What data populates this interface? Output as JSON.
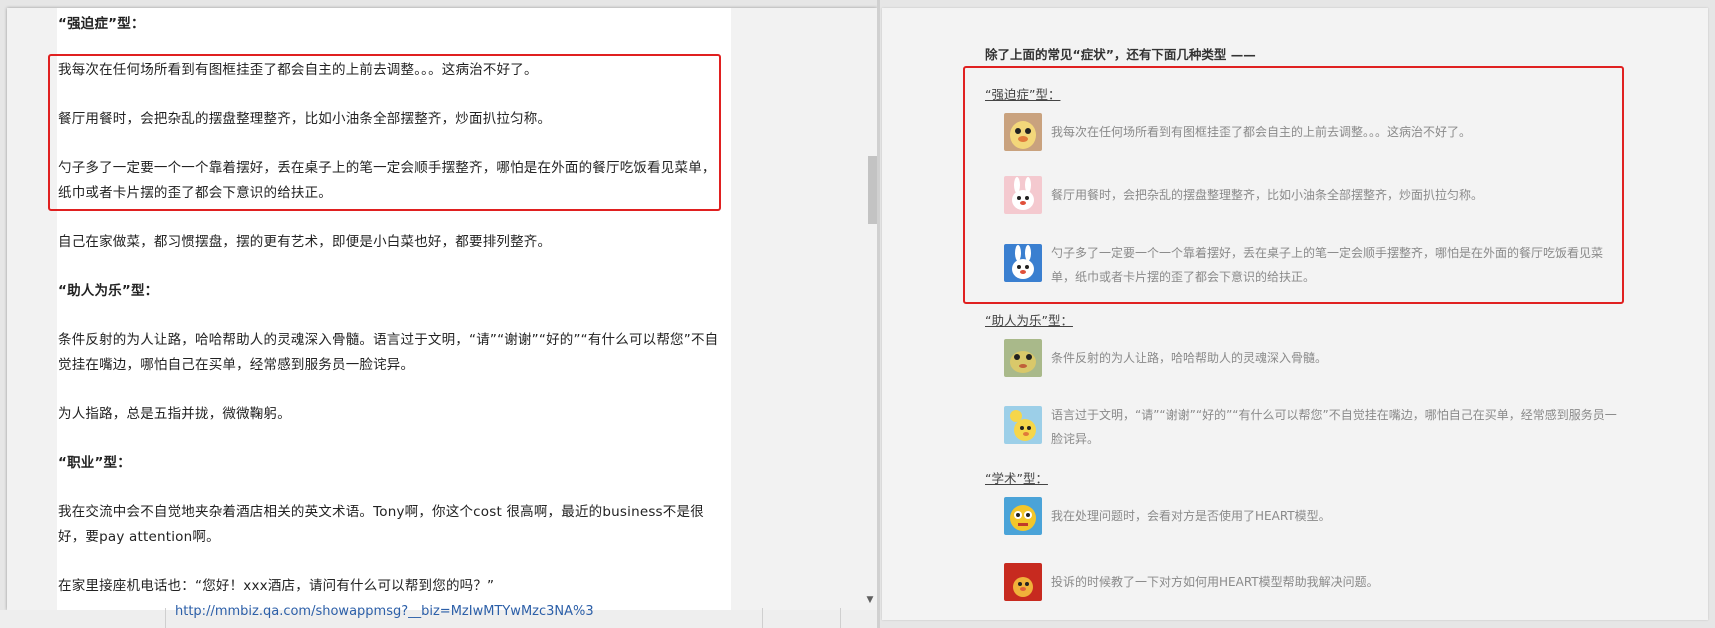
{
  "left_doc": {
    "paragraphs": [
      {
        "text": "“强迫症”型：",
        "bold": true
      },
      {
        "text": "我每次在任何场所看到有图框挂歪了都会自主的上前去调整。。。这病治不好了。",
        "bold": false
      },
      {
        "text": "餐厅用餐时，会把杂乱的摆盘整理整齐，比如小油条全部摆整齐，炒面扒拉匀称。",
        "bold": false
      },
      {
        "text": "勺子多了一定要一个一个靠着摆好，丢在桌子上的笔一定会顺手摆整齐，哪怕是在外面的餐厅吃饭看见菜单，纸巾或者卡片摆的歪了都会下意识的给扶正。",
        "bold": false
      },
      {
        "text": "自己在家做菜，都习惯摆盘，摆的更有艺术，即便是小白菜也好，都要排列整齐。",
        "bold": false
      },
      {
        "text": "“助人为乐”型：",
        "bold": true
      },
      {
        "text": "条件反射的为人让路，哈哈帮助人的灵魂深入骨髓。语言过于文明，“请”“谢谢”“好的”“有什么可以帮您”不自觉挂在嘴边，哪怕自己在买单，经常感到服务员一脸诧异。",
        "bold": false
      },
      {
        "text": "为人指路，总是五指并拢，微微鞠躬。",
        "bold": false
      },
      {
        "text": "“职业”型：",
        "bold": true
      },
      {
        "text": "我在交流中会不自觉地夹杂着酒店相关的英文术语。Tony啊，你这个cost 很高啊，最近的business不是很好，要pay attention啊。",
        "bold": false
      },
      {
        "text": "在家里接座机电话也：“您好！xxx酒店，请问有什么可以帮到您的吗？”",
        "bold": false
      }
    ],
    "link_text": "http://mmbiz.qa.com/showappmsg?__biz=MzIwMTYwMzc3NA%3"
  },
  "right_doc": {
    "intro": "除了上面的常见“症状”，还有下面几种类型 ——",
    "sections": [
      {
        "heading": "“强迫症”型：",
        "items": [
          {
            "avatar": "duck-avatar",
            "text": "我每次在任何场所看到有图框挂歪了都会自主的上前去调整。。。这病治不好了。"
          },
          {
            "avatar": "bunny-pink-avatar",
            "text": "餐厅用餐时，会把杂乱的摆盘整理整齐，比如小油条全部摆整齐，炒面扒拉匀称。"
          },
          {
            "avatar": "bunny-blue-avatar",
            "text": "勺子多了一定要一个一个靠着摆好，丢在桌子上的笔一定会顺手摆整齐，哪怕是在外面的餐厅吃饭看见菜单，纸巾或者卡片摆的歪了都会下意识的给扶正。"
          }
        ]
      },
      {
        "heading": "“助人为乐”型：",
        "items": [
          {
            "avatar": "frog-avatar",
            "text": "条件反射的为人让路，哈哈帮助人的灵魂深入骨髓。"
          },
          {
            "avatar": "duck-flower-avatar",
            "text": "语言过于文明，“请”“谢谢”“好的”“有什么可以帮您”不自觉挂在嘴边，哪怕自己在买单，经常感到服务员一脸诧异。"
          }
        ]
      },
      {
        "heading": "“学术”型：",
        "items": [
          {
            "avatar": "yellow-cat-avatar",
            "text": "我在处理问题时，会看对方是否使用了HEART模型。"
          },
          {
            "avatar": "red-bird-avatar",
            "text": "投诉的时候教了一下对方如何用HEART模型帮助我解决问题。"
          }
        ]
      }
    ]
  },
  "colors": {
    "highlight": "#e02020",
    "link": "#2c5fa8",
    "muted_text": "#8a8a8a"
  }
}
